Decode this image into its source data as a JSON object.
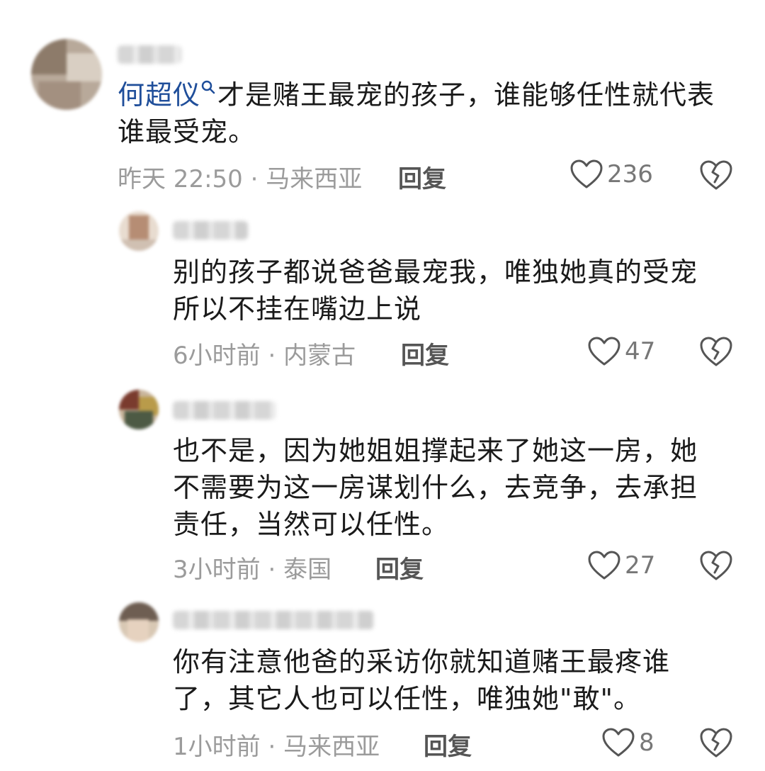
{
  "comments": [
    {
      "mention": "何超仪",
      "text": "才是赌王最宠的孩子，谁能够任性就代表谁最受宠。",
      "time": "昨天 22:50",
      "location": "马来西亚",
      "reply_label": "回复",
      "likes": "236"
    },
    {
      "text": "别的孩子都说爸爸最宠我，唯独她真的受宠所以不挂在嘴边上说",
      "time": "6小时前",
      "location": "内蒙古",
      "reply_label": "回复",
      "likes": "47"
    },
    {
      "text": "也不是，因为她姐姐撑起来了她这一房，她不需要为这一房谋划什么，去竞争，去承担责任，当然可以任性。",
      "time": "3小时前",
      "location": "泰国",
      "reply_label": "回复",
      "likes": "27"
    },
    {
      "text": "你有注意他爸的采访你就知道赌王最疼谁了，其它人也可以任性，唯独她\"敢\"。",
      "time": "1小时前",
      "location": "马来西亚",
      "reply_label": "回复",
      "likes": "8"
    }
  ],
  "separator": " · ",
  "icons": {
    "like": "heart-outline-icon",
    "dislike": "broken-heart-icon",
    "mention": "search-icon"
  },
  "colors": {
    "mention": "#1f4e9a",
    "meta": "#9b9b9b"
  }
}
